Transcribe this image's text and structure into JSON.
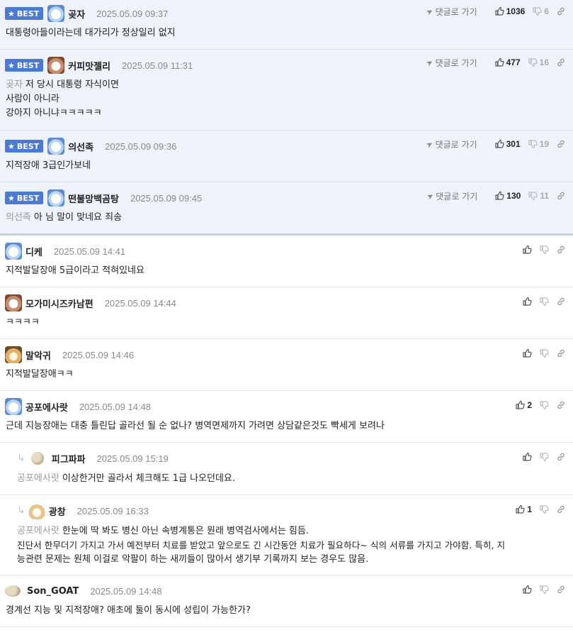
{
  "labels": {
    "best": "BEST",
    "goto": "댓글로 가기"
  },
  "best_comments": [
    {
      "nick": "곶자",
      "date": "2025.05.09 09:37",
      "up": "1036",
      "down": "6",
      "lines": [
        "대통령아들이라는데 대가리가 정상일리 없지"
      ],
      "mention": ""
    },
    {
      "nick": "커피맛젤리",
      "date": "2025.05.09 11:31",
      "up": "477",
      "down": "16",
      "mention": "곶자",
      "lines": [
        "저 당시 대통령 자식이면",
        "사람이 아니라",
        "강아지 아니냐ㅋㅋㅋㅋㅋ"
      ]
    },
    {
      "nick": "의선족",
      "date": "2025.05.09 09:36",
      "up": "301",
      "down": "19",
      "lines": [
        "지적장애 3급인가보네"
      ],
      "mention": ""
    },
    {
      "nick": "떤불망백곰탕",
      "date": "2025.05.09 09:45",
      "up": "130",
      "down": "11",
      "mention": "의선족",
      "lines": [
        "아 님 말이 맞네요 죄송"
      ]
    }
  ],
  "comments": [
    {
      "nick": "디케",
      "date": "2025.05.09 14:41",
      "up": "",
      "lines": [
        "지적발달장애 5급이라고 적혀있네요"
      ]
    },
    {
      "nick": "모가미시즈카남편",
      "date": "2025.05.09 14:44",
      "up": "",
      "lines": [
        "ㅋㅋㅋㅋ"
      ]
    },
    {
      "nick": "말악귀",
      "date": "2025.05.09 14:46",
      "up": "",
      "lines": [
        "지적발달장애ㅋㅋ"
      ]
    },
    {
      "nick": "공포에사랏",
      "date": "2025.05.09 14:48",
      "up": "2",
      "lines": [
        "근데 지능장애는 대충 틀린답 골라선 될 순 없나? 병역면제까지 가려면 상담같은것도 빡세게 보려나"
      ]
    }
  ],
  "replies": [
    {
      "nick": "피그파파",
      "date": "2025.05.09 15:19",
      "up": "",
      "mention": "공포에사랏",
      "lines": [
        "이상한거만 골라서 체크해도 1급 나오던데요."
      ]
    },
    {
      "nick": "광창",
      "date": "2025.05.09 16:33",
      "up": "1",
      "mention": "공포에사랏",
      "lines": [
        "한눈에 딱 봐도 병신 아닌 속병계통은 원래 병역검사에서는 힘듬.",
        "진단서 한무더기 가지고 가서 예전부터 치료를 받았고 앞으로도 긴 시간동안 치료가 필요하다~ 식의 서류를 가지고 가야함. 특히, 지",
        "능관련 문제는 원체 이걸로 악팔이 하는 새끼들이 많아서 생기부 기록까지 보는 경우도 많음."
      ]
    }
  ],
  "last_comment": {
    "nick": "Son_GOAT",
    "date": "2025.05.09 14:48",
    "up": "",
    "lines": [
      "경계선 지능 및 지적장애? 애초에 둘이 동시에 성립이 가능한가?"
    ]
  },
  "colors": {
    "best_bg": "#eef2fb",
    "badge": "#4b7ad3"
  }
}
